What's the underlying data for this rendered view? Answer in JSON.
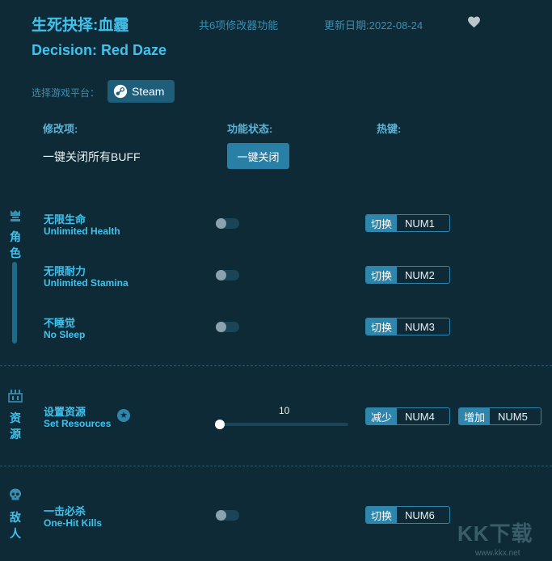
{
  "header": {
    "title_cn": "生死抉择:血霾",
    "title_en": "Decision: Red Daze",
    "feature_count": "共6项修改器功能",
    "updated": "更新日期:2022-08-24",
    "favorite_icon": "heart-icon"
  },
  "platform": {
    "label": "选择游戏平台：",
    "button_label": "Steam",
    "icon": "steam-icon"
  },
  "columns": {
    "option": "修改项:",
    "status": "功能状态:",
    "hotkey": "热键:"
  },
  "disable_all": {
    "label": "一键关闭所有BUFF",
    "button_label": "一键关闭"
  },
  "categories": {
    "character": {
      "label_1": "角",
      "label_2": "色",
      "icon": "character-icon"
    },
    "resources": {
      "label_1": "资",
      "label_2": "源",
      "icon": "resources-icon"
    },
    "enemies": {
      "label_1": "敌",
      "label_2": "人",
      "icon": "skull-icon"
    }
  },
  "options": {
    "health": {
      "cn": "无限生命",
      "en": "Unlimited Health",
      "enabled": false,
      "action": "切换",
      "key": "NUM1"
    },
    "stamina": {
      "cn": "无限耐力",
      "en": "Unlimited Stamina",
      "enabled": false,
      "action": "切换",
      "key": "NUM2"
    },
    "sleep": {
      "cn": "不睡觉",
      "en": "No Sleep",
      "enabled": false,
      "action": "切换",
      "key": "NUM3"
    },
    "resources": {
      "cn": "设置资源",
      "en": "Set Resources",
      "value": "10",
      "decrease_action": "减少",
      "decrease_key": "NUM4",
      "increase_action": "增加",
      "increase_key": "NUM5",
      "star": "★"
    },
    "onehit": {
      "cn": "一击必杀",
      "en": "One-Hit Kills",
      "enabled": false,
      "action": "切换",
      "key": "NUM6"
    }
  },
  "watermark": {
    "logo": "KK下载",
    "url": "www.kkx.net"
  },
  "colors": {
    "background": "#0e2a37",
    "accent": "#3ec3ee",
    "button": "#2980a6"
  }
}
